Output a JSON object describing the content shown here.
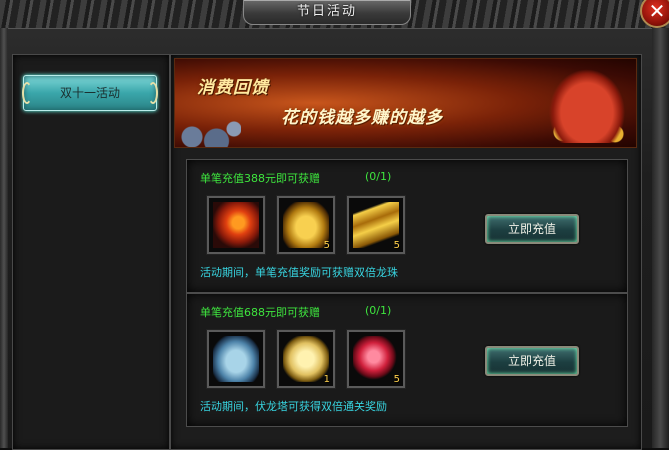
{
  "window": {
    "title": "节日活动",
    "close_symbol": "✕"
  },
  "sidebar": {
    "items": [
      {
        "label": "双十一活动",
        "selected": true
      }
    ]
  },
  "banner": {
    "title": "消费回馈",
    "slogan": "花的钱越多赚的越多"
  },
  "rewards": [
    {
      "condition": "单笔充值388元即可获赠",
      "progress": "(0/1)",
      "items": [
        {
          "icon": "fire-dragon-icon",
          "qty": ""
        },
        {
          "icon": "gold-ore-icon",
          "qty": "5"
        },
        {
          "icon": "gold-bars-icon",
          "qty": "5"
        }
      ],
      "button_label": "立即充值",
      "note": "活动期间，单笔充值奖励可获赠双倍龙珠"
    },
    {
      "condition": "单笔充值688元即可获赠",
      "progress": "(0/1)",
      "items": [
        {
          "icon": "armor-icon",
          "qty": ""
        },
        {
          "icon": "scroll-icon",
          "qty": "1"
        },
        {
          "icon": "red-gem-icon",
          "qty": "5"
        }
      ],
      "button_label": "立即充值",
      "note": "活动期间，伏龙塔可获得双倍通关奖励"
    }
  ],
  "colors": {
    "condition_text": "#3ee53e",
    "note_text": "#38d4e0",
    "tab_accent": "#3aa6aa",
    "qty_text": "#ffd04a"
  }
}
